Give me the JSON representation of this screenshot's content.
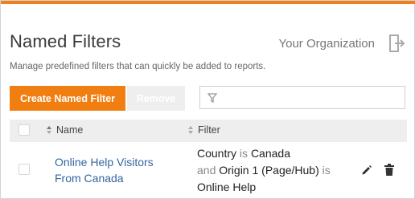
{
  "header": {
    "title": "Named Filters",
    "organization_link": "Your Organization",
    "subtitle": "Manage predefined filters that can quickly be added to reports."
  },
  "toolbar": {
    "create_label": "Create Named Filter",
    "remove_label": "Remove",
    "filter_placeholder": ""
  },
  "table": {
    "columns": [
      "Name",
      "Filter"
    ],
    "rows": [
      {
        "name_line1": "Online Help Visitors",
        "name_line2": "From Canada",
        "filter": {
          "field1": "Country",
          "op1": "is",
          "value1": "Canada",
          "conj": "and",
          "field2": "Origin 1 (Page/Hub)",
          "op2": "is",
          "value2": "Online Help"
        }
      }
    ]
  },
  "colors": {
    "accent": "#f07e10",
    "link": "#3366a0"
  },
  "icons": [
    "exit-icon",
    "funnel-icon",
    "sort-icon",
    "edit-pencil-icon",
    "trash-icon"
  ]
}
